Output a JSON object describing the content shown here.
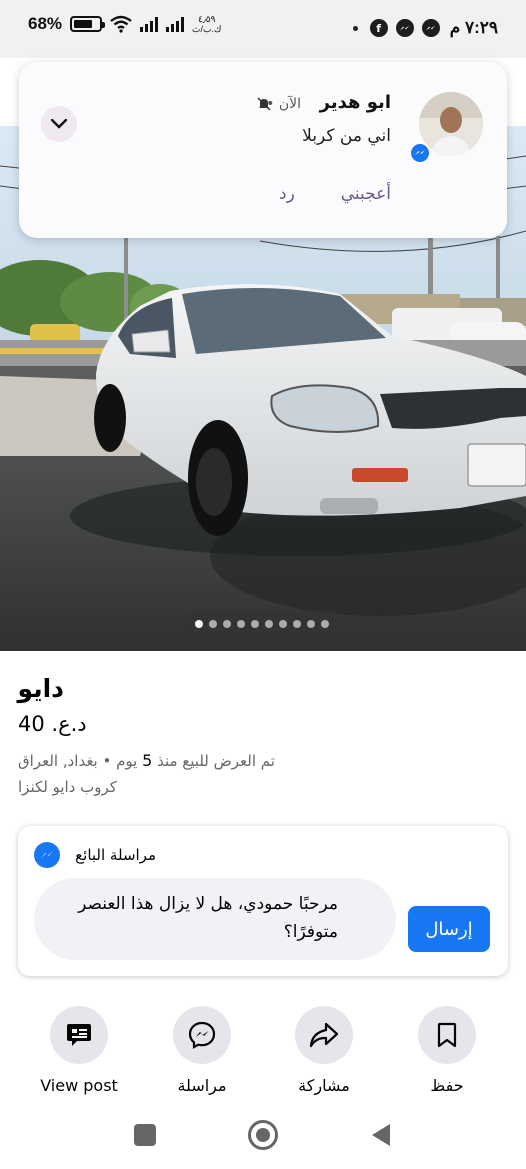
{
  "status_bar": {
    "time": "٧:٢٩ م",
    "battery": "68%",
    "speed_top": "٤٫٥٩",
    "speed_bottom": "ك.ب/ث"
  },
  "notification": {
    "sender": "ابو هدير",
    "time": "• الآن",
    "message": "اني من كربلا",
    "like_action": "أعجبني",
    "reply_action": "رد"
  },
  "listing": {
    "photo_count": 10,
    "active_photo": 0,
    "title": "دايو",
    "price": "40 .د.ع",
    "listed_prefix": "تم العرض للبيع منذ",
    "listed_days": "5",
    "listed_suffix": "يوم • بغداد, العراق",
    "group": "كروب دايو لكنزا"
  },
  "message_seller": {
    "title": "مراسلة البائع",
    "draft": "مرحبًا حمودي، هل لا يزال هذا العنصر متوفرًا؟",
    "send_label": "إرسال"
  },
  "actions": {
    "view_post": "View post",
    "message": "مراسلة",
    "share": "مشاركة",
    "save": "حفظ"
  },
  "colors": {
    "accent": "#1877f2",
    "notification_action": "#6a5a8a",
    "circle_bg": "#e4e6eb"
  }
}
